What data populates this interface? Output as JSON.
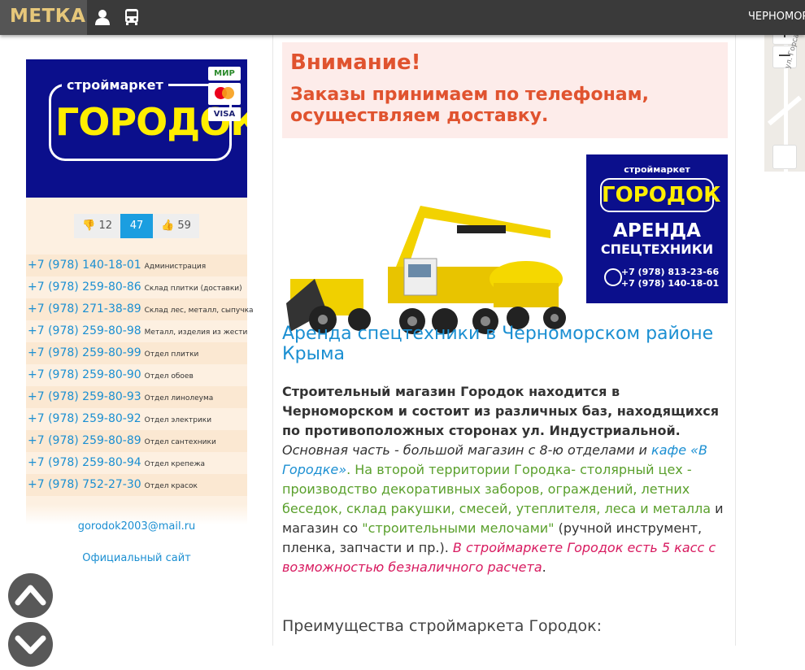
{
  "header": {
    "brand": "МЕТКА",
    "user_icon": "user-icon",
    "bus_icon": "bus-icon",
    "town": "ЧЕРНОМОРСКОЕ"
  },
  "map": {
    "zoom_in": "+",
    "zoom_out": "−",
    "street_label": "ул. Горса"
  },
  "sidebar": {
    "logo": {
      "small": "строймаркет",
      "big": "ГОРОДОК"
    },
    "cards": [
      "МИР",
      "mastercard",
      "VISA"
    ],
    "votes": {
      "down": "12",
      "total": "47",
      "up": "59"
    },
    "phones": [
      {
        "number": "+7 (978) 140-18-01",
        "desc": "Администрация"
      },
      {
        "number": "+7 (978) 259-80-86",
        "desc": "Склад плитки (доставки)"
      },
      {
        "number": "+7 (978) 271-38-89",
        "desc": "Склад лес, металл, сыпучка"
      },
      {
        "number": "+7 (978) 259-80-98",
        "desc": "Металл, изделия из жести"
      },
      {
        "number": "+7 (978) 259-80-99",
        "desc": "Отдел плитки"
      },
      {
        "number": "+7 (978) 259-80-90",
        "desc": "Отдел обоев"
      },
      {
        "number": "+7 (978) 259-80-93",
        "desc": "Отдел линолеума"
      },
      {
        "number": "+7 (978) 259-80-92",
        "desc": "Отдел электрики"
      },
      {
        "number": "+7 (978) 259-80-89",
        "desc": "Отдел сантехники"
      },
      {
        "number": "+7 (978) 259-80-94",
        "desc": "Отдел крепежа"
      },
      {
        "number": "+7 (978) 752-27-30",
        "desc": "Отдел красок"
      }
    ],
    "email": "gorodok2003@mail.ru",
    "site": "Официальный сайт"
  },
  "main": {
    "alert_heading": "Внимание!",
    "alert_text": "Заказы принимаем по телефонам, осуществляем доставку.",
    "rent_banner": {
      "small": "строймаркет",
      "big": "ГОРОДОК",
      "line1": "АРЕНДА",
      "line2": "СПЕЦТЕХНИКИ",
      "phone1": "+7 (978) 813-23-66",
      "phone2": "+7 (978) 140-18-01"
    },
    "title": "Аренда спецтехники в Черноморском районе Крыма",
    "p_bold": "Строительный магазин Городок находится в Черноморском и состоит из различных баз, находящихся по противоположных сторонах ул. Индустриальной.",
    "p_italic": "Основная часть - большой магазин с 8-ю отделами и",
    "p_link": "кафе «В Городке»",
    "p_green1": ". На второй территории Городка- столярный цех - производство декоративных заборов, ограждений, летних беседок, склад ракушки, смесей, утеплителя, леса и металла",
    "p_plain1": " и магазин со ",
    "p_green2": "\"строительными мелочами\"",
    "p_plain2": " (ручной инструмент, пленка, запчасти и пр.). ",
    "p_pink": "В строймаркете Городок есть 5 касс с возможностью безналичного расчета",
    "p_end": ".",
    "advantages": "Преимущества строймаркета Городок:"
  },
  "colors": {
    "accent": "#1b8fd2",
    "alert": "#e0532f",
    "navy": "#0b0f8c",
    "yellow": "#ffee00"
  }
}
